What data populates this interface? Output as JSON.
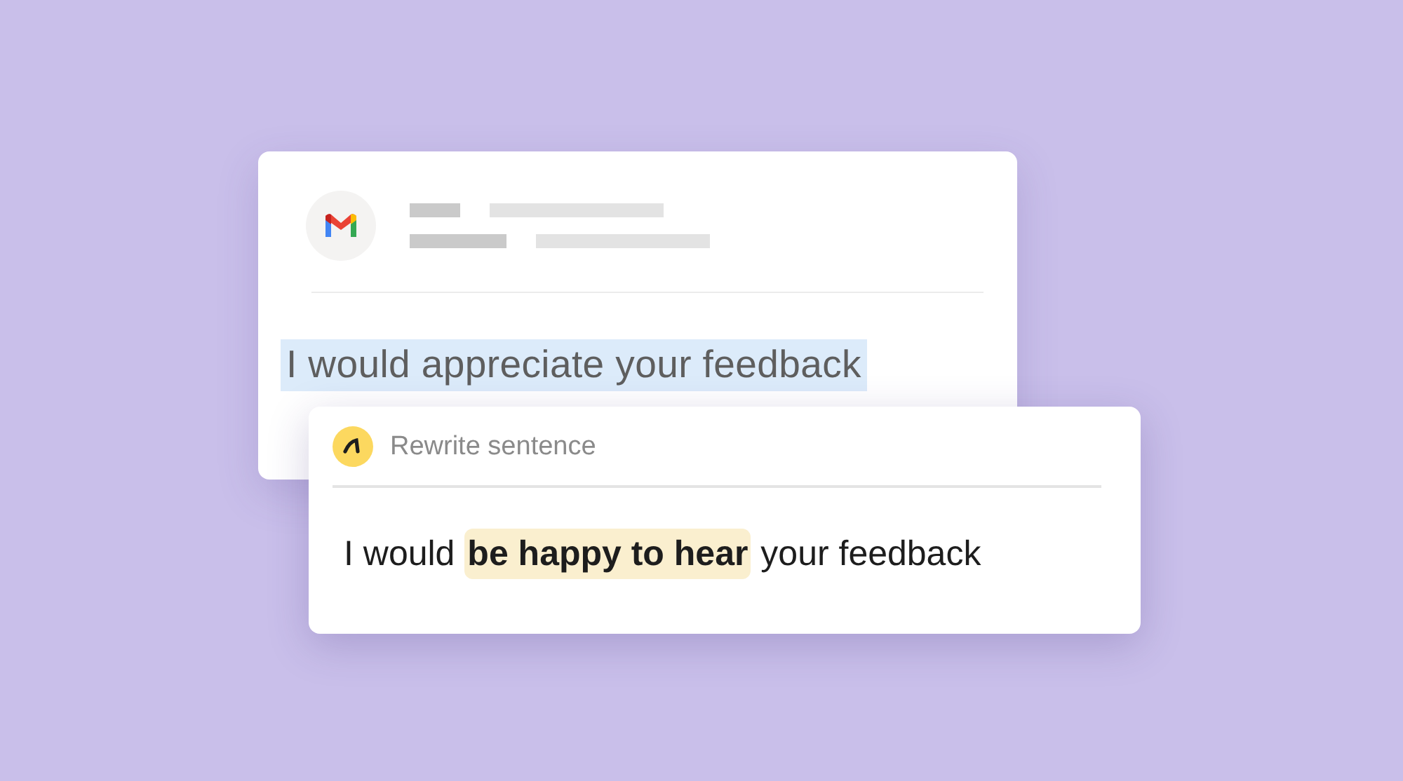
{
  "email_card": {
    "sentence": "I would appreciate your feedback",
    "selected": true
  },
  "rewrite_popup": {
    "title": "Rewrite sentence",
    "sentence": "I would **be happy to hear** your feedback"
  }
}
